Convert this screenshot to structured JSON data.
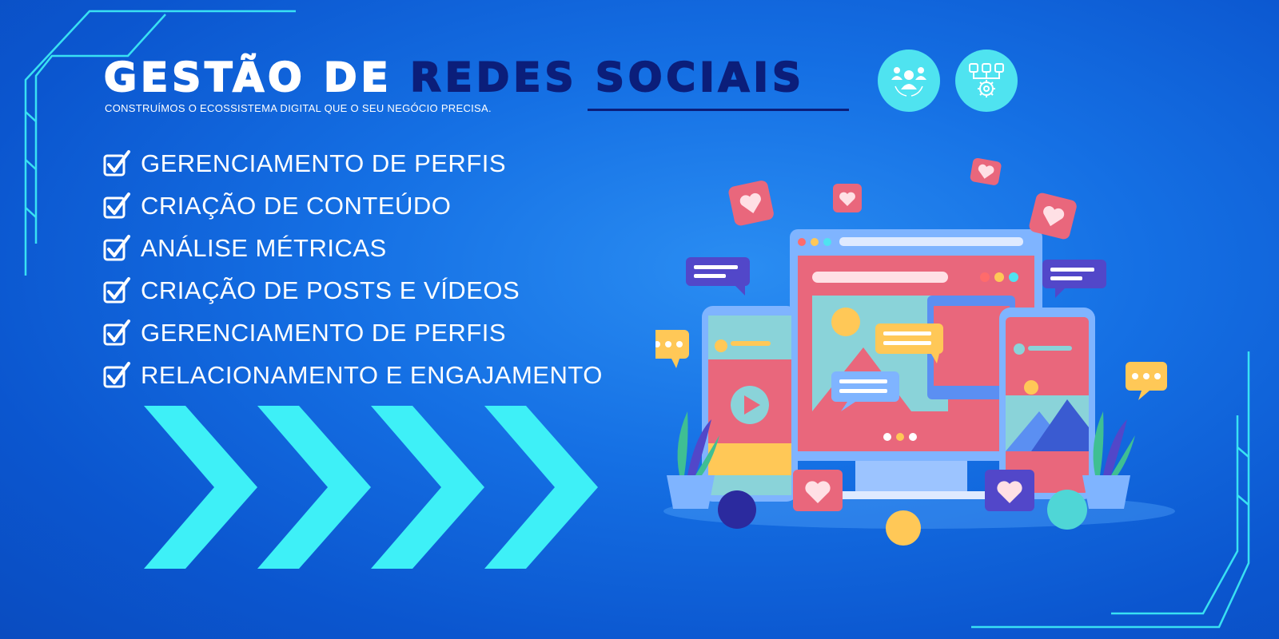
{
  "banner": {
    "title_part1": "GESTÃO DE",
    "title_part2": "REDES SOCIAIS",
    "subtitle": "CONSTRUÍMOS O ECOSSISTEMA DIGITAL QUE O SEU NEGÓCIO PRECISA."
  },
  "badges": [
    {
      "icon": "people-network-icon"
    },
    {
      "icon": "social-apps-gear-icon"
    }
  ],
  "features": [
    {
      "label": "GERENCIAMENTO DE PERFIS"
    },
    {
      "label": "CRIAÇÃO DE CONTEÚDO"
    },
    {
      "label": "ANÁLISE MÉTRICAS"
    },
    {
      "label": "CRIAÇÃO DE POSTS E VÍDEOS"
    },
    {
      "label": "GERENCIAMENTO DE PERFIS"
    },
    {
      "label": "RELACIONAMENTO E ENGAJAMENTO"
    }
  ],
  "colors": {
    "background": "#1570e4",
    "title_white": "#ffffff",
    "title_navy": "#0b1e7a",
    "accent_cyan": "#3ef0f7",
    "badge": "#4fe3f0"
  }
}
